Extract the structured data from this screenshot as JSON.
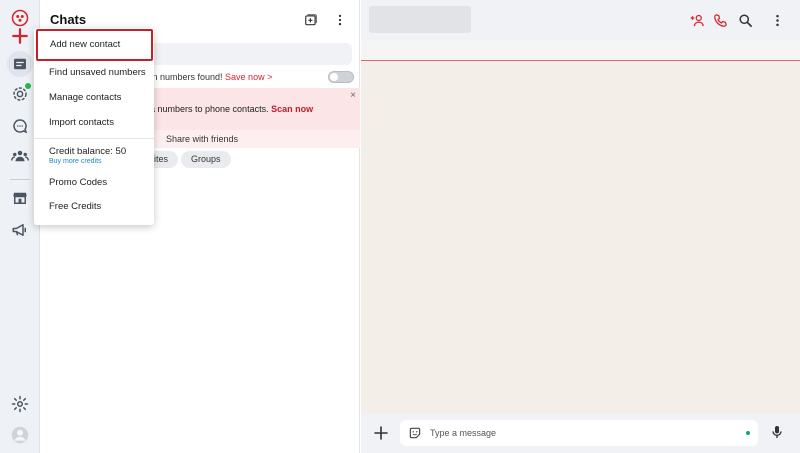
{
  "panel": {
    "title": "Chats",
    "unsaved_text": "wn numbers found! ",
    "unsaved_link": "Save now >",
    "banner_text": "a numbers to phone contacts. ",
    "banner_link": "Scan now",
    "banner_close": "×",
    "share_text": "Share with friends",
    "filters": [
      "ites",
      "Groups"
    ]
  },
  "menu": {
    "items": [
      "Add new contact",
      "Find unsaved numbers",
      "Manage contacts",
      "Import contacts"
    ],
    "credit_label": "Credit balance: 50",
    "credit_sub": "Buy more credits",
    "bottom_items": [
      "Promo Codes",
      "Free Credits"
    ]
  },
  "composer": {
    "placeholder": "Type a message"
  },
  "colors": {
    "accent": "#d7232f",
    "banner": "#fbe5e6",
    "link_blue": "#1e88c7"
  }
}
